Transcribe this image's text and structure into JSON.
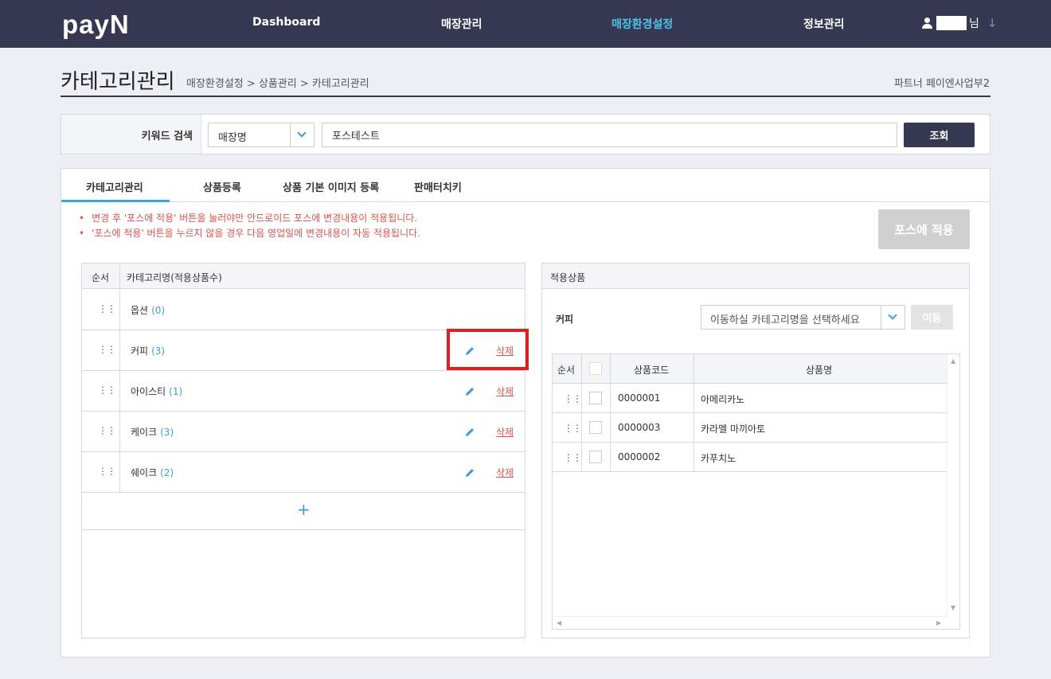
{
  "brand": {
    "logo": "payN"
  },
  "nav": {
    "items": [
      {
        "label": "Dashboard"
      },
      {
        "label": "매장관리"
      },
      {
        "label": "매장환경설정"
      },
      {
        "label": "정보관리"
      }
    ],
    "user_suffix": "님"
  },
  "page": {
    "title": "카테고리관리",
    "breadcrumb": "매장환경설정 > 상품관리 > 카테고리관리",
    "partner": "파트너 페이엔사업부2"
  },
  "search": {
    "label": "키워드 검색",
    "field_selected": "매장명",
    "keyword": "포스테스트",
    "button": "조회"
  },
  "tabs": [
    {
      "label": "카테고리관리"
    },
    {
      "label": "상품등록"
    },
    {
      "label": "상품 기본 이미지 등록"
    },
    {
      "label": "판매터치키"
    }
  ],
  "notices": [
    "변경 후 '포스에 적용' 버튼을 눌러야만 안드로이드 포스에 변경내용이 적용됩니다.",
    "'포스에 적용' 버튼을 누르지 않을 경우 다음 영업일에 변경내용이 자동 적용됩니다."
  ],
  "apply_button": "포스에 적용",
  "category_table": {
    "headers": [
      "순서",
      "카테고리명(적용상품수)"
    ],
    "rows": [
      {
        "name": "옵션",
        "count": "(0)",
        "editable": false
      },
      {
        "name": "커피",
        "count": "(3)",
        "editable": true,
        "delete_label": "삭제"
      },
      {
        "name": "아이스티",
        "count": "(1)",
        "editable": true,
        "delete_label": "삭제"
      },
      {
        "name": "케이크",
        "count": "(3)",
        "editable": true,
        "delete_label": "삭제"
      },
      {
        "name": "쉐이크",
        "count": "(2)",
        "editable": true,
        "delete_label": "삭제"
      }
    ],
    "add_label": "+"
  },
  "products": {
    "title": "적용상품",
    "current_category": "커피",
    "move_placeholder": "이동하실 카테고리명을 선택하세요",
    "move_button": "이동",
    "headers": [
      "순서",
      "상품코드",
      "상품명"
    ],
    "rows": [
      {
        "code": "0000001",
        "name": "아메리카노"
      },
      {
        "code": "0000003",
        "name": "카라멜 마끼아토"
      },
      {
        "code": "0000002",
        "name": "카푸치노"
      }
    ]
  },
  "colors": {
    "topbar": "#363851",
    "nav_active": "#4fc3e6",
    "accent": "#3a9fd6",
    "danger": "#d9534f",
    "highlight": "#e01e1e"
  }
}
